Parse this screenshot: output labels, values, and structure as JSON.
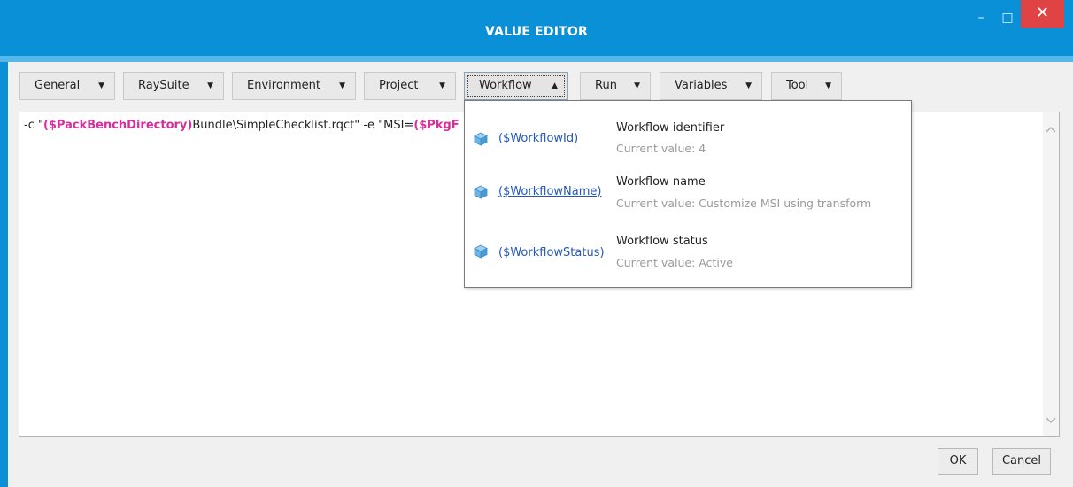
{
  "window": {
    "title": "VALUE EDITOR",
    "minimize_glyph": "–",
    "maximize_glyph": "□",
    "close_glyph": "✕",
    "close_color": "#e04343",
    "accent": "#0a90d6"
  },
  "toolbar": {
    "menus": [
      {
        "label": "General",
        "arrow": "▼"
      },
      {
        "label": "RaySuite",
        "arrow": "▼"
      },
      {
        "label": "Environment",
        "arrow": "▼"
      },
      {
        "label": "Project",
        "arrow": "▼"
      },
      {
        "label": "Workflow",
        "arrow": "▲",
        "open": true
      },
      {
        "label": "Run",
        "arrow": "▼"
      },
      {
        "label": "Variables",
        "arrow": "▼"
      },
      {
        "label": "Tool",
        "arrow": "▼"
      }
    ]
  },
  "editor": {
    "segments": [
      {
        "text": "-c \""
      },
      {
        "text": "($PackBenchDirectory)",
        "variable": true
      },
      {
        "text": "Bundle\\SimpleChecklist.rqct\"  -e \"MSI="
      },
      {
        "text": "($PkgF",
        "variable": true
      }
    ],
    "scroll_up_glyph": "﹀",
    "scroll_down_glyph": "﹀"
  },
  "workflow_dropdown": {
    "items": [
      {
        "variable": "($WorkflowId)",
        "label": "Workflow identifier",
        "value": "Current value: 4",
        "icon": "cube-icon"
      },
      {
        "variable": "($WorkflowName)",
        "label": "Workflow name",
        "value": "Current value: Customize MSI using transform",
        "icon": "cube-icon",
        "hover": true
      },
      {
        "variable": "($WorkflowStatus)",
        "label": "Workflow status",
        "value": "Current value: Active",
        "icon": "cube-icon"
      }
    ]
  },
  "footer": {
    "ok_label": "OK",
    "cancel_label": "Cancel"
  }
}
